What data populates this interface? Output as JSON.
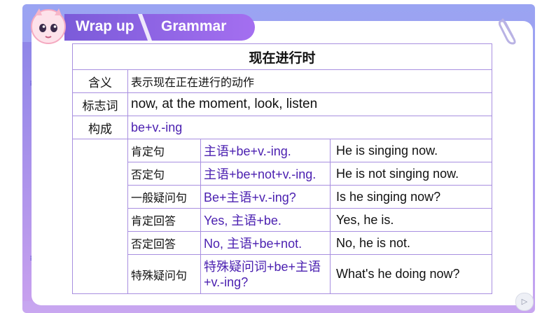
{
  "header": {
    "tab_wrap_up": "Wrap up",
    "tab_grammar": "Grammar"
  },
  "table": {
    "title": "现在进行时",
    "rows": [
      {
        "label": "含义",
        "value": "表示现在正在进行的动作"
      },
      {
        "label": "标志词",
        "value": "now, at the moment, look, listen"
      },
      {
        "label": "构成",
        "value": "be+v.-ing"
      }
    ],
    "sentences": [
      {
        "type": "肯定句",
        "structure": "主语+be+v.-ing.",
        "example": "He is singing now."
      },
      {
        "type": "否定句",
        "structure": "主语+be+not+v.-ing.",
        "example": "He is not singing now."
      },
      {
        "type": "一般疑问句",
        "structure": "Be+主语+v.-ing?",
        "example": "Is he singing now?"
      },
      {
        "type": "肯定回答",
        "structure": "Yes, 主语+be.",
        "example": "Yes, he is."
      },
      {
        "type": "否定回答",
        "structure": "No, 主语+be+not.",
        "example": "No, he is not."
      },
      {
        "type": "特殊疑问句",
        "structure": "特殊疑问词+be+主语+v.-ing?",
        "example": "What's he doing now?"
      }
    ]
  },
  "colors": {
    "accent": "#7b5bd9",
    "border": "#a88fe0",
    "structure_text": "#4a1fb0"
  },
  "icons": {
    "mascot": "dragon-mascot-icon",
    "clip": "paperclip-icon",
    "play": "play-icon",
    "grip": "grip-icon"
  }
}
